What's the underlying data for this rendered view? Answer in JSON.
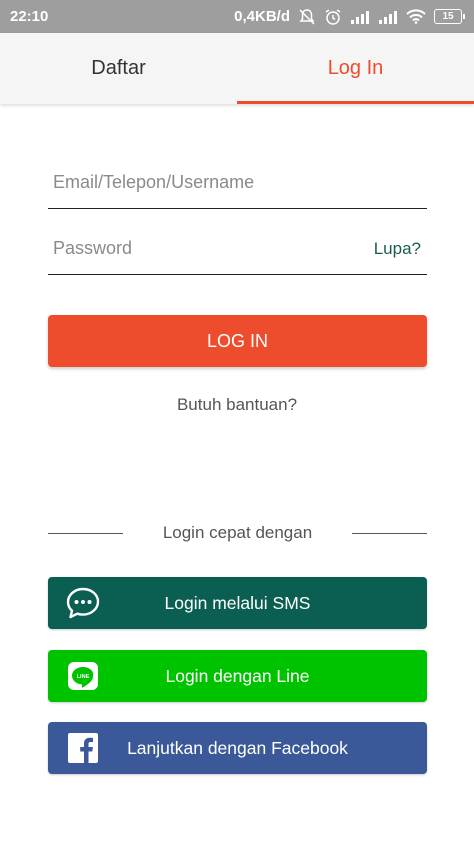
{
  "status_bar": {
    "time": "22:10",
    "net_speed": "0,4KB/d",
    "battery": "15"
  },
  "tabs": [
    {
      "label": "Daftar",
      "active": false
    },
    {
      "label": "Log In",
      "active": true
    }
  ],
  "form": {
    "username_placeholder": "Email/Telepon/Username",
    "password_placeholder": "Password",
    "forgot_label": "Lupa?",
    "login_label": "LOG IN",
    "help_label": "Butuh bantuan?"
  },
  "quick_login": {
    "divider_text": "Login cepat dengan",
    "sms": {
      "label": "Login melalui SMS",
      "icon": "chat-bubble-icon",
      "color": "#0b5f52"
    },
    "line": {
      "label": "Login dengan Line",
      "icon": "line-logo-icon",
      "icon_text": "LINE",
      "color": "#00c300"
    },
    "facebook": {
      "label": "Lanjutkan dengan Facebook",
      "icon": "facebook-logo-icon",
      "color": "#3b5998"
    }
  },
  "colors": {
    "accent": "#ee4d2d",
    "status_bar": "#9e9e9e"
  }
}
